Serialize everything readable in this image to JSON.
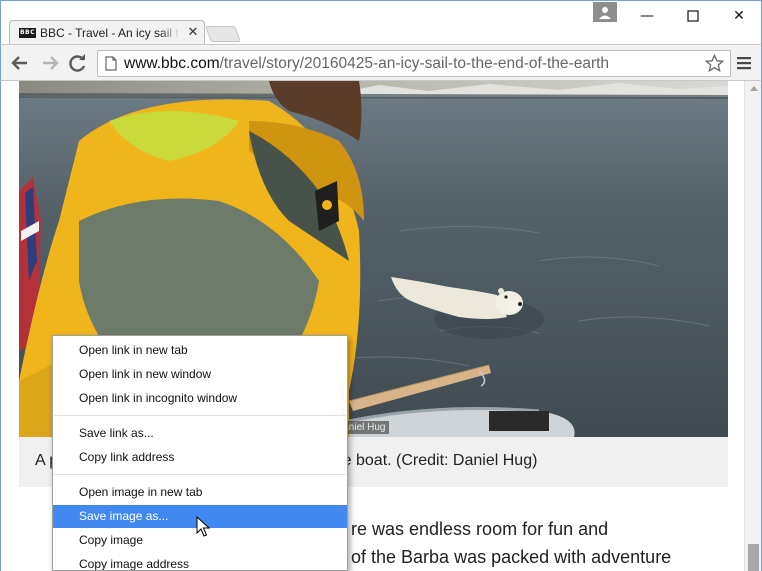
{
  "browser": {
    "tab": {
      "favicon_text": "BBC",
      "title": "BBC - Travel - An icy sail to the end of the earth",
      "close_glyph": "✕"
    },
    "window_controls": {
      "minimize": "—",
      "maximize": "☐",
      "close": "✕"
    },
    "address_bar": {
      "host": "www.bbc.com",
      "path": "/travel/story/20160425-an-icy-sail-to-the-end-of-the-earth"
    },
    "icons": [
      "back-arrow-icon",
      "forward-arrow-icon",
      "reload-icon",
      "page-icon",
      "bookmark-star-icon",
      "menu-icon",
      "profile-icon"
    ]
  },
  "page": {
    "photo": {
      "credit_overlay": "Daniel Hug"
    },
    "caption": "A p                                                   roach the boat. (Credit: Daniel Hug)",
    "body_lines": [
      "re was endless room for fun and",
      "of the Barba was packed with adventure"
    ]
  },
  "context_menu": {
    "groups": [
      [
        "Open link in new tab",
        "Open link in new window",
        "Open link in incognito window"
      ],
      [
        "Save link as...",
        "Copy link address"
      ],
      [
        "Open image in new tab",
        "Save image as...",
        "Copy image",
        "Copy image address"
      ]
    ],
    "highlighted_item": "Save image as..."
  },
  "colors": {
    "menu_highlight": "#4189f0",
    "window_border": "#7a9fd6",
    "jacket_yellow": "#f1b51c",
    "sea": "#4f5a62"
  }
}
